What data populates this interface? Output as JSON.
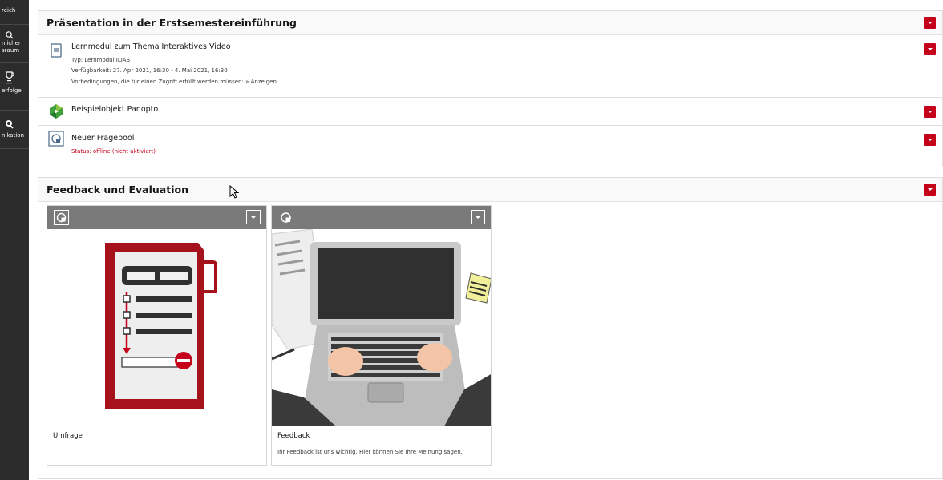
{
  "mainbar": {
    "items": [
      {
        "label_line1": "",
        "label_line2": "reich",
        "icon": "repository-icon"
      },
      {
        "label_line1": "nlicher",
        "label_line2": "sraum",
        "icon": "search-icon"
      },
      {
        "label_line1": "",
        "label_line2": "erfolge",
        "icon": "trophy-icon"
      },
      {
        "label_line1": "",
        "label_line2": "nikation",
        "icon": "communication-icon"
      }
    ]
  },
  "blocks": [
    {
      "title": "Präsentation in der Erstsemestereinführung",
      "items": [
        {
          "icon": "learning-module-icon",
          "title": "Lernmodul zum Thema Interaktives Video",
          "props": [
            "Typ: Lernmodul ILIAS",
            "Verfügbarkeit: 27. Apr 2021, 16:30 - 4. Mai 2021, 16:30",
            "Vorbedingungen, die für einen Zugriff erfüllt werden müssen: » Anzeigen"
          ]
        },
        {
          "icon": "panopto-icon",
          "title": "Beispielobjekt Panopto",
          "props": []
        },
        {
          "icon": "question-pool-icon",
          "title": "Neuer Fragepool",
          "alert": "Status: offline (nicht aktiviert)"
        }
      ]
    },
    {
      "title": "Feedback und Evaluation",
      "tiles": [
        {
          "icon": "survey-icon",
          "title": "Umfrage",
          "description": ""
        },
        {
          "icon": "survey-icon",
          "title": "Feedback",
          "description": "Ihr Feedback ist uns wichtig. Hier können Sie Ihre Meinung sagen."
        }
      ]
    }
  ],
  "colors": {
    "accent": "#c4001a",
    "mainbar": "#2c2c2c",
    "tile_bar": "#7a7a7a",
    "panopto_green": "#3fa03b"
  }
}
